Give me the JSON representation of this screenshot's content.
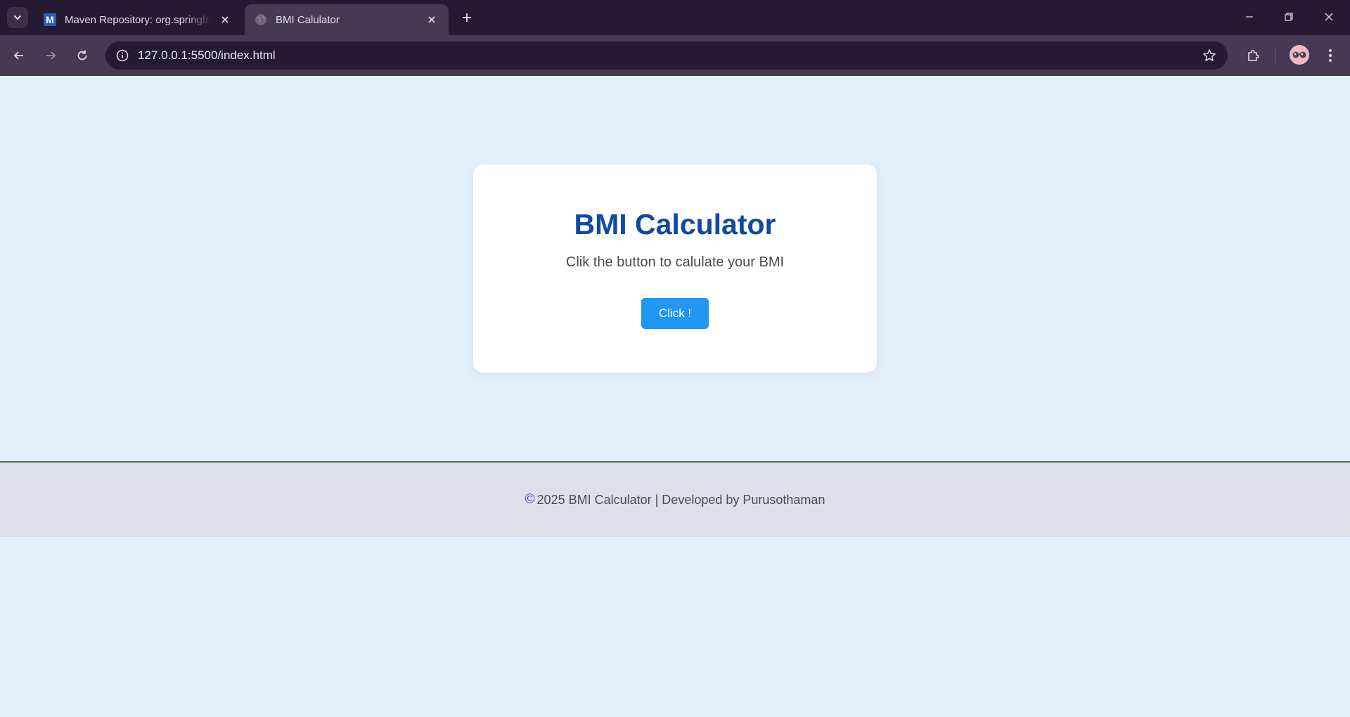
{
  "browser": {
    "tabs": [
      {
        "title": "Maven Repository: org.springframework",
        "favicon": "maven-m-icon",
        "active": false
      },
      {
        "title": "BMI Calulator",
        "favicon": "globe-icon",
        "active": true
      }
    ],
    "url": "127.0.0.1:5500/index.html"
  },
  "page": {
    "heading": "BMI Calculator",
    "subtitle": "Clik the button to calulate your BMI",
    "button_label": "Click !",
    "footer": {
      "copyright_symbol": "©",
      "text": "2025 BMI Calculator | Developed by Purusothaman"
    }
  },
  "colors": {
    "page_background": "#e2f0fc",
    "heading": "#0e4aa1",
    "button": "#2196f3",
    "footer_background": "#dde0e8",
    "footer_border": "#55695b",
    "chrome_dark": "#251a33",
    "chrome_toolbar": "#443a53"
  }
}
